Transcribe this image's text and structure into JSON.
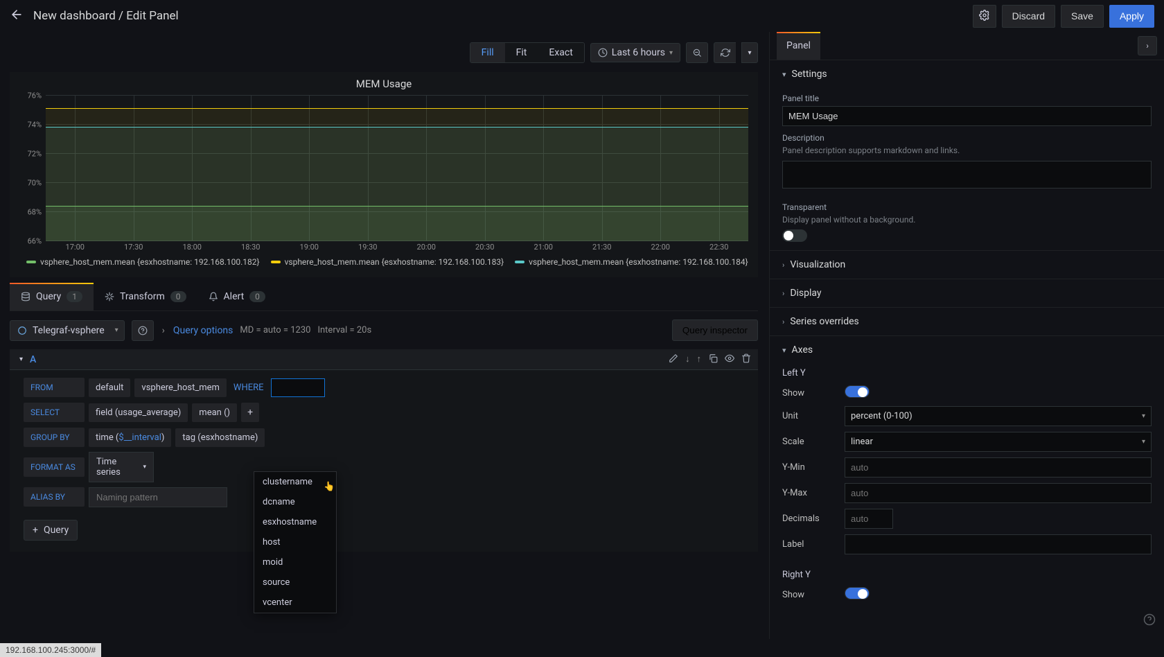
{
  "header": {
    "breadcrumb": "New dashboard / Edit Panel",
    "discard": "Discard",
    "save": "Save",
    "apply": "Apply"
  },
  "preview_toolbar": {
    "seg_fill": "Fill",
    "seg_fit": "Fit",
    "seg_exact": "Exact",
    "time_label": "Last 6 hours"
  },
  "panel": {
    "title": "MEM Usage"
  },
  "chart_data": {
    "type": "line",
    "title": "MEM Usage",
    "xlabel": "",
    "ylabel": "",
    "ylim": [
      66,
      76
    ],
    "x": [
      "17:00",
      "17:30",
      "18:00",
      "18:30",
      "19:00",
      "19:30",
      "20:00",
      "20:30",
      "21:00",
      "21:30",
      "22:00",
      "22:30"
    ],
    "series": [
      {
        "name": "vsphere_host_mem.mean {esxhostname: 192.168.100.182}",
        "color": "#73bf69",
        "values": [
          68.4,
          68.4,
          68.4,
          68.4,
          68.4,
          68.4,
          68.4,
          68.4,
          68.4,
          68.4,
          68.4,
          68.4
        ]
      },
      {
        "name": "vsphere_host_mem.mean {esxhostname: 192.168.100.183}",
        "color": "#f2cc0c",
        "values": [
          75.1,
          75.1,
          75.1,
          75.1,
          75.1,
          75.1,
          75.1,
          75.1,
          75.1,
          75.1,
          75.1,
          75.1
        ]
      },
      {
        "name": "vsphere_host_mem.mean {esxhostname: 192.168.100.184}",
        "color": "#5ac8c8",
        "values": [
          73.8,
          73.8,
          73.8,
          73.8,
          73.8,
          73.8,
          73.8,
          73.8,
          73.8,
          73.8,
          73.8,
          73.8
        ]
      }
    ],
    "y_ticks": [
      "66%",
      "68%",
      "70%",
      "72%",
      "74%",
      "76%"
    ]
  },
  "tabs": {
    "query": "Query",
    "query_badge": "1",
    "transform": "Transform",
    "transform_badge": "0",
    "alert": "Alert",
    "alert_badge": "0"
  },
  "query_bar": {
    "datasource": "Telegraf-vsphere",
    "options_link": "Query options",
    "md_label": "MD = auto = 1230",
    "interval_label": "Interval = 20s",
    "inspector": "Query inspector"
  },
  "query_a": {
    "letter": "A",
    "from_label": "FROM",
    "from_default": "default",
    "from_measurement": "vsphere_host_mem",
    "where_label": "WHERE",
    "where_input_value": "",
    "select_label": "SELECT",
    "select_field": "field (usage_average)",
    "select_mean": "mean ()",
    "groupby_label": "GROUP BY",
    "groupby_time_prefix": "time (",
    "groupby_time_var": "$__interval",
    "groupby_time_suffix": ")",
    "groupby_tag": "tag (esxhostname)",
    "formatas_label": "FORMAT AS",
    "formatas_value": "Time series",
    "aliasby_label": "ALIAS BY",
    "aliasby_placeholder": "Naming pattern"
  },
  "where_dropdown": [
    "clustername",
    "dcname",
    "esxhostname",
    "host",
    "moid",
    "source",
    "vcenter"
  ],
  "add_query": "Query",
  "right": {
    "panel_tab": "Panel",
    "settings": {
      "head": "Settings",
      "title_label": "Panel title",
      "title_value": "MEM Usage",
      "desc_label": "Description",
      "desc_hint": "Panel description supports markdown and links.",
      "transparent_label": "Transparent",
      "transparent_hint": "Display panel without a background."
    },
    "viz_head": "Visualization",
    "display_head": "Display",
    "series_head": "Series overrides",
    "axes": {
      "head": "Axes",
      "left_y": "Left Y",
      "right_y": "Right Y",
      "show": "Show",
      "unit": "Unit",
      "unit_value": "percent (0-100)",
      "scale": "Scale",
      "scale_value": "linear",
      "ymin": "Y-Min",
      "ymax": "Y-Max",
      "decimals": "Decimals",
      "label": "Label",
      "auto_ph": "auto"
    }
  },
  "status_url": "192.168.100.245:3000/#"
}
